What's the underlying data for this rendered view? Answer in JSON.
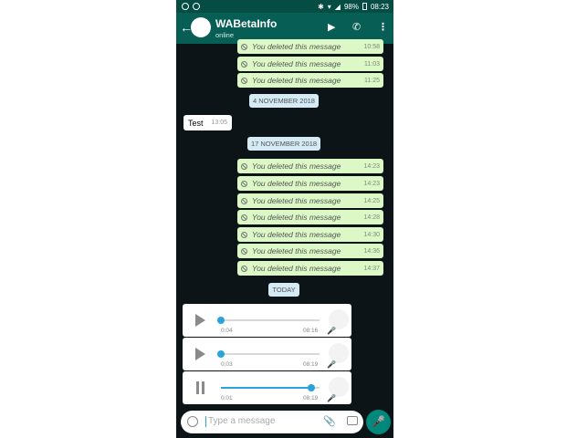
{
  "status_bar": {
    "battery": "98%",
    "time": "08:23"
  },
  "header": {
    "back_icon": "arrow-left-icon",
    "avatar_glyph": "",
    "contact_name": "WABetaInfo",
    "contact_status": "online",
    "icons": [
      "video-call-icon",
      "phone-call-icon",
      "more-vert-icon"
    ]
  },
  "messages_top": [
    {
      "text": "You deleted this message",
      "time": "10:58"
    },
    {
      "text": "You deleted this message",
      "time": "11:03"
    },
    {
      "text": "You deleted this message",
      "time": "11:25"
    }
  ],
  "date_1": "4 NOVEMBER 2018",
  "incoming": {
    "text": "Test",
    "time": "13:05"
  },
  "date_2": "17 NOVEMBER 2018",
  "messages_mid": [
    {
      "text": "You deleted this message",
      "time": "14:23"
    },
    {
      "text": "You deleted this message",
      "time": "14:23"
    },
    {
      "text": "You deleted this message",
      "time": "14:25"
    },
    {
      "text": "You deleted this message",
      "time": "14:28"
    },
    {
      "text": "You deleted this message",
      "time": "14:30"
    },
    {
      "text": "You deleted this message",
      "time": "14:36"
    },
    {
      "text": "You deleted this message",
      "time": "14:37"
    }
  ],
  "date_3": "TODAY",
  "voice_notes": [
    {
      "state": "paused",
      "elapsed": "0:04",
      "time": "08:16",
      "progress": 0.0
    },
    {
      "state": "paused",
      "elapsed": "0:03",
      "time": "08:19",
      "progress": 0.0
    },
    {
      "state": "playing",
      "elapsed": "0:01",
      "time": "08:19",
      "progress": 0.92
    }
  ],
  "input": {
    "placeholder": "Type a message"
  },
  "colors": {
    "header": "#075e54",
    "outgoing": "#dcf8c6",
    "accent": "#29a3dc",
    "send": "#00897b"
  }
}
